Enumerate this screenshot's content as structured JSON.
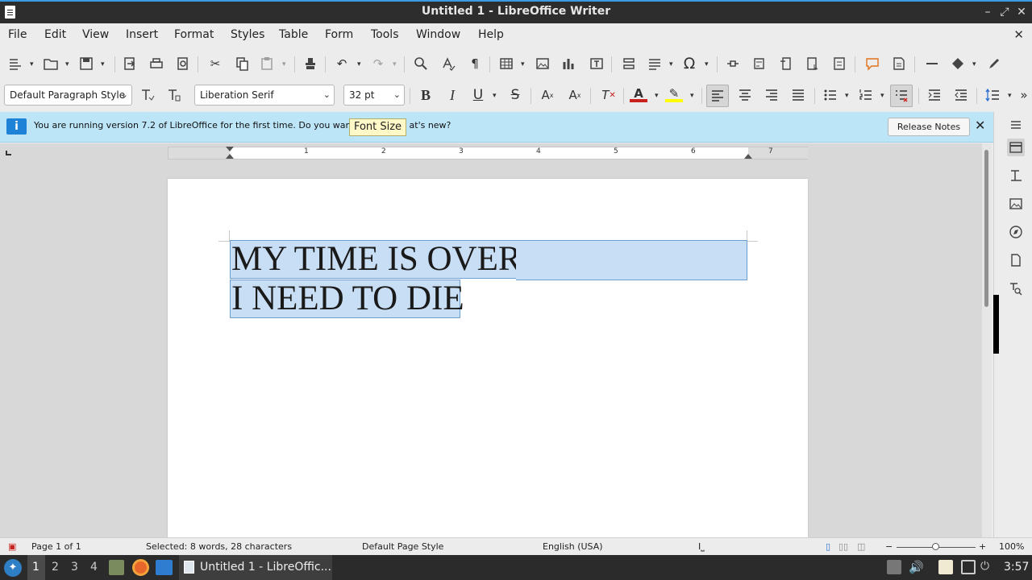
{
  "window": {
    "title": "Untitled 1 - LibreOffice Writer"
  },
  "menu": [
    "File",
    "Edit",
    "View",
    "Insert",
    "Format",
    "Styles",
    "Table",
    "Form",
    "Tools",
    "Window",
    "Help"
  ],
  "formatting": {
    "paragraph_style": "Default Paragraph Style",
    "font_name": "Liberation Serif",
    "font_size": "32 pt"
  },
  "infobar": {
    "message": "You are running version 7.2 of LibreOffice for the first time. Do you wan",
    "message_tail": "at's new?",
    "release_notes_label": "Release Notes"
  },
  "tooltip": "Font Size",
  "ruler": {
    "numbers": [
      "1",
      "2",
      "3",
      "4",
      "5",
      "6",
      "7"
    ]
  },
  "document": {
    "lines": [
      "MY TIME IS OVER",
      "I NEED TO DIE"
    ]
  },
  "status": {
    "page": "Page 1 of 1",
    "selection": "Selected: 8 words, 28 characters",
    "page_style": "Default Page Style",
    "language": "English (USA)",
    "zoom": "100%"
  },
  "taskbar": {
    "workspaces": [
      "1",
      "2",
      "3",
      "4"
    ],
    "task_label": "Untitled 1 - LibreOffic...",
    "clock": "3:57"
  },
  "colors": {
    "selection": "#c8def4",
    "infobar": "#bde5f8",
    "font_color": "#c9211e",
    "highlight": "#ffff00"
  }
}
